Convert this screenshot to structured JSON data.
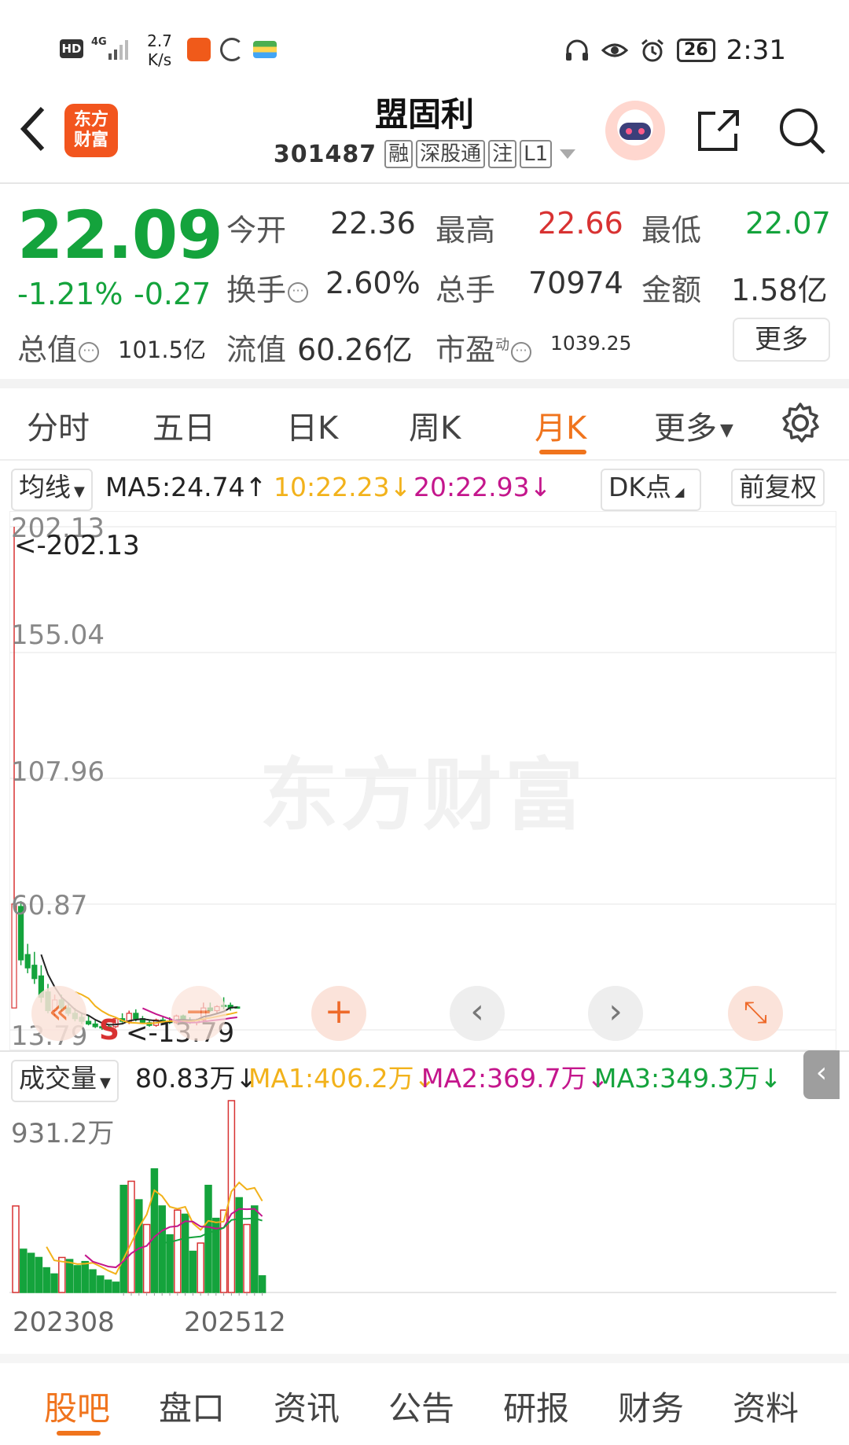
{
  "status_bar": {
    "network_badge": "HD",
    "network_type": "4G",
    "speed_value": "2.7",
    "speed_unit": "K/s",
    "battery": "26",
    "time": "2:31"
  },
  "header": {
    "logo_text_line1": "东方",
    "logo_text_line2": "财富",
    "stock_name": "盟固利",
    "stock_code": "301487",
    "tags": [
      "融",
      "深股通",
      "注",
      "L1"
    ]
  },
  "quote": {
    "price": "22.09",
    "change_pct": "-1.21%",
    "change_abs": "-0.27",
    "open_label": "今开",
    "open": "22.36",
    "high_label": "最高",
    "high": "22.66",
    "low_label": "最低",
    "low": "22.07",
    "turnover_label": "换手",
    "turnover": "2.60%",
    "volume_label": "总手",
    "volume": "70974",
    "amount_label": "金额",
    "amount": "1.58亿",
    "mktcap_label": "总值",
    "mktcap": "101.5亿",
    "float_label": "流值",
    "float": "60.26亿",
    "pe_label": "市盈",
    "pe_sup": "动",
    "pe": "1039.25",
    "more_label": "更多"
  },
  "tabs": [
    "分时",
    "五日",
    "日K",
    "周K",
    "月K",
    "更多"
  ],
  "active_tab": "月K",
  "ma_bar": {
    "indicator": "均线",
    "ma5": "MA5:24.74",
    "ma10": "10:22.23",
    "ma20": "20:22.93",
    "dk_label": "DK点",
    "adjust_label": "前复权"
  },
  "price_axis": {
    "ticks": [
      "202.13",
      "155.04",
      "107.96",
      "60.87",
      "13.79"
    ],
    "max_marker": "<-202.13",
    "min_marker": "<-13.79",
    "signal": "S"
  },
  "watermark": "东方财富",
  "chart_controls": [
    "«",
    "−",
    "+",
    "‹",
    "›",
    "⤡"
  ],
  "volume_bar": {
    "indicator": "成交量",
    "value": "80.83万",
    "ma1": "MA1:406.2万",
    "ma2": "MA2:369.7万",
    "ma3": "MA3:349.3万",
    "max_tick": "931.2万"
  },
  "x_dates": [
    "202308",
    "202512"
  ],
  "bottom_nav": [
    "股吧",
    "盘口",
    "资讯",
    "公告",
    "研报",
    "财务",
    "资料"
  ],
  "colors": {
    "up": "#d83232",
    "down": "#14a33c",
    "accent": "#f0741d",
    "ma5": "#222222",
    "ma10": "#f2b21b",
    "ma20": "#c4168c"
  },
  "chart_data": {
    "type": "candlestick",
    "y_range": [
      13.79,
      202.13
    ],
    "candles": [
      {
        "o": 60.9,
        "h": 202.13,
        "l": 22.0,
        "c": 22.0,
        "dir": "up"
      },
      {
        "o": 60.0,
        "h": 62.0,
        "l": 38.0,
        "c": 40.0,
        "dir": "down"
      },
      {
        "o": 42.0,
        "h": 46.0,
        "l": 35.0,
        "c": 37.0,
        "dir": "down"
      },
      {
        "o": 38.0,
        "h": 43.0,
        "l": 31.0,
        "c": 33.0,
        "dir": "down"
      },
      {
        "o": 34.0,
        "h": 38.0,
        "l": 24.0,
        "c": 26.0,
        "dir": "down"
      },
      {
        "o": 28.0,
        "h": 31.0,
        "l": 20.0,
        "c": 21.0,
        "dir": "down"
      },
      {
        "o": 21.0,
        "h": 27.0,
        "l": 19.0,
        "c": 25.0,
        "dir": "up"
      },
      {
        "o": 25.0,
        "h": 27.0,
        "l": 21.0,
        "c": 22.0,
        "dir": "down"
      },
      {
        "o": 22.0,
        "h": 24.0,
        "l": 19.0,
        "c": 20.0,
        "dir": "down"
      },
      {
        "o": 20.0,
        "h": 22.0,
        "l": 17.0,
        "c": 18.0,
        "dir": "down"
      },
      {
        "o": 18.5,
        "h": 20.0,
        "l": 16.0,
        "c": 17.0,
        "dir": "down"
      },
      {
        "o": 17.0,
        "h": 19.0,
        "l": 15.5,
        "c": 16.0,
        "dir": "down"
      },
      {
        "o": 16.0,
        "h": 17.5,
        "l": 14.5,
        "c": 15.0,
        "dir": "down"
      },
      {
        "o": 15.0,
        "h": 16.5,
        "l": 13.79,
        "c": 14.5,
        "dir": "down"
      },
      {
        "o": 14.5,
        "h": 16.0,
        "l": 14.0,
        "c": 15.0,
        "dir": "down"
      },
      {
        "o": 15.0,
        "h": 18.5,
        "l": 14.5,
        "c": 18.0,
        "dir": "up"
      },
      {
        "o": 18.0,
        "h": 20.0,
        "l": 16.5,
        "c": 17.0,
        "dir": "down"
      },
      {
        "o": 17.0,
        "h": 21.0,
        "l": 16.0,
        "c": 20.0,
        "dir": "up"
      },
      {
        "o": 20.0,
        "h": 21.5,
        "l": 17.0,
        "c": 18.0,
        "dir": "down"
      },
      {
        "o": 18.0,
        "h": 19.0,
        "l": 16.0,
        "c": 16.5,
        "dir": "down"
      },
      {
        "o": 16.5,
        "h": 17.5,
        "l": 15.0,
        "c": 15.5,
        "dir": "down"
      },
      {
        "o": 15.5,
        "h": 18.0,
        "l": 15.0,
        "c": 17.5,
        "dir": "up"
      },
      {
        "o": 17.5,
        "h": 19.0,
        "l": 16.5,
        "c": 17.0,
        "dir": "down"
      },
      {
        "o": 17.0,
        "h": 18.5,
        "l": 16.0,
        "c": 16.5,
        "dir": "down"
      },
      {
        "o": 16.5,
        "h": 19.5,
        "l": 16.0,
        "c": 19.0,
        "dir": "up"
      },
      {
        "o": 19.0,
        "h": 19.5,
        "l": 17.0,
        "c": 17.5,
        "dir": "down"
      },
      {
        "o": 17.5,
        "h": 18.5,
        "l": 16.0,
        "c": 16.5,
        "dir": "down"
      },
      {
        "o": 16.5,
        "h": 18.0,
        "l": 15.5,
        "c": 17.5,
        "dir": "up"
      },
      {
        "o": 17.5,
        "h": 24.0,
        "l": 17.0,
        "c": 22.0,
        "dir": "up"
      },
      {
        "o": 22.0,
        "h": 24.0,
        "l": 20.5,
        "c": 21.0,
        "dir": "down"
      },
      {
        "o": 21.0,
        "h": 23.0,
        "l": 20.0,
        "c": 22.5,
        "dir": "up"
      },
      {
        "o": 22.5,
        "h": 26.0,
        "l": 21.5,
        "c": 23.0,
        "dir": "down"
      },
      {
        "o": 23.0,
        "h": 24.0,
        "l": 21.0,
        "c": 22.0,
        "dir": "down"
      },
      {
        "o": 22.36,
        "h": 22.66,
        "l": 22.07,
        "c": 22.09,
        "dir": "down"
      }
    ],
    "ma5": [
      null,
      null,
      null,
      null,
      42.0,
      34.6,
      29.8,
      26.0,
      23.8,
      21.4,
      20.0,
      19.2,
      17.6,
      16.4,
      15.7,
      15.8,
      16.1,
      17.2,
      17.6,
      17.9,
      17.5,
      17.2,
      17.0,
      16.6,
      17.5,
      17.6,
      17.4,
      17.5,
      18.7,
      19.2,
      19.9,
      20.7,
      22.1,
      22.3
    ],
    "ma10": [
      null,
      null,
      null,
      null,
      null,
      null,
      null,
      null,
      null,
      28.0,
      27.0,
      25.6,
      22.7,
      20.8,
      19.4,
      18.5,
      17.3,
      16.5,
      16.4,
      16.2,
      16.2,
      16.4,
      16.8,
      17.1,
      17.0,
      17.0,
      17.0,
      17.3,
      17.9,
      18.3,
      18.8,
      19.3,
      19.8,
      20.4
    ],
    "ma20": [
      null,
      null,
      null,
      null,
      null,
      null,
      null,
      null,
      null,
      null,
      null,
      null,
      null,
      null,
      null,
      null,
      null,
      null,
      null,
      21.9,
      20.8,
      19.7,
      18.8,
      17.9,
      17.2,
      16.7,
      16.5,
      16.6,
      16.9,
      17.2,
      17.5,
      17.8,
      18.2,
      18.5
    ],
    "volume": {
      "max": 931.2,
      "unit": "万",
      "values": [
        420,
        210,
        190,
        170,
        120,
        90,
        170,
        160,
        130,
        150,
        110,
        80,
        60,
        50,
        520,
        540,
        450,
        330,
        600,
        420,
        280,
        400,
        380,
        200,
        240,
        520,
        360,
        400,
        931.2,
        460,
        330,
        420,
        80.83
      ],
      "dir": [
        "up",
        "down",
        "down",
        "down",
        "down",
        "down",
        "up",
        "down",
        "down",
        "down",
        "down",
        "down",
        "down",
        "down",
        "down",
        "up",
        "down",
        "up",
        "down",
        "down",
        "down",
        "up",
        "down",
        "down",
        "up",
        "down",
        "down",
        "up",
        "up",
        "down",
        "up",
        "down",
        "down"
      ],
      "ma1": [
        null,
        null,
        null,
        null,
        222,
        156,
        150,
        146,
        138,
        140,
        144,
        126,
        106,
        90,
        164,
        240,
        318,
        378,
        496,
        468,
        416,
        406,
        416,
        336,
        304,
        348,
        340,
        344,
        490,
        534,
        500,
        508,
        444
      ],
      "ma2": [
        null,
        null,
        null,
        null,
        null,
        null,
        null,
        null,
        null,
        182,
        150,
        138,
        126,
        122,
        152,
        190,
        214,
        226,
        270,
        300,
        318,
        322,
        346,
        344,
        320,
        318,
        310,
        314,
        382,
        406,
        404,
        406,
        370
      ],
      "ma3": [
        null,
        null,
        null,
        null,
        null,
        null,
        null,
        null,
        null,
        null,
        null,
        null,
        null,
        null,
        null,
        null,
        null,
        null,
        null,
        241,
        244,
        254,
        264,
        268,
        272,
        290,
        300,
        314,
        352,
        358,
        358,
        360,
        349
      ]
    }
  }
}
